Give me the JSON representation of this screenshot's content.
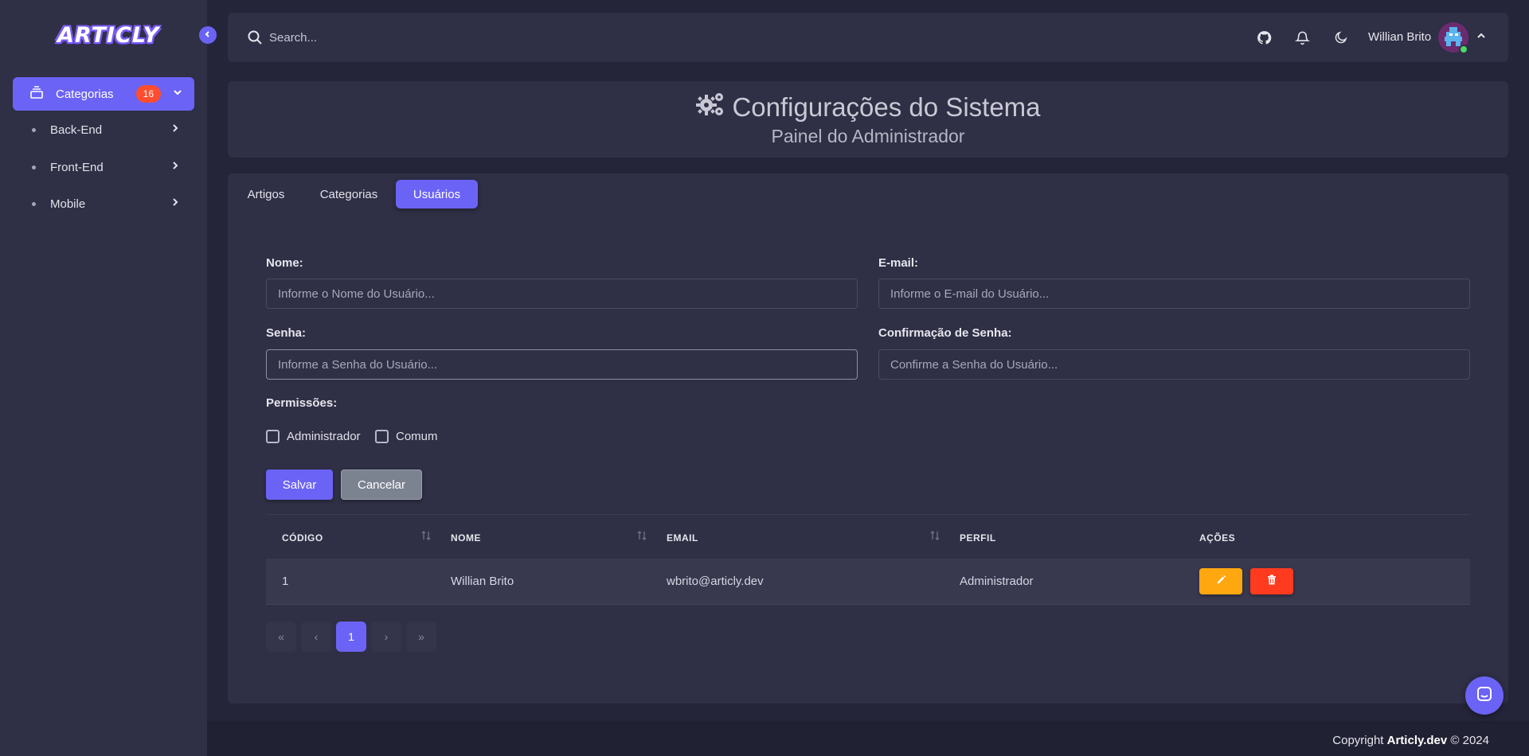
{
  "app": {
    "logo_text": "ARTICLY"
  },
  "sidebar": {
    "main_item": {
      "label": "Categorias",
      "badge": "16"
    },
    "items": [
      {
        "label": "Back-End"
      },
      {
        "label": "Front-End"
      },
      {
        "label": "Mobile"
      }
    ]
  },
  "topbar": {
    "search_placeholder": "Search...",
    "user_name": "Willian Brito",
    "icons": [
      "github-icon",
      "bell-icon",
      "moon-icon"
    ]
  },
  "header": {
    "title": "Configurações do Sistema",
    "subtitle": "Painel do Administrador"
  },
  "tabs": [
    {
      "label": "Artigos",
      "active": false
    },
    {
      "label": "Categorias",
      "active": false
    },
    {
      "label": "Usuários",
      "active": true
    }
  ],
  "form": {
    "nome_label": "Nome:",
    "nome_placeholder": "Informe o Nome do Usuário...",
    "email_label": "E-mail:",
    "email_placeholder": "Informe o E-mail do Usuário...",
    "senha_label": "Senha:",
    "senha_placeholder": "Informe a Senha do Usuário...",
    "confirm_label": "Confirmação de Senha:",
    "confirm_placeholder": "Confirme a Senha do Usuário...",
    "permissions_label": "Permissões:",
    "perm_admin": "Administrador",
    "perm_common": "Comum",
    "save_label": "Salvar",
    "cancel_label": "Cancelar"
  },
  "table": {
    "headers": [
      "CÓDIGO",
      "NOME",
      "EMAIL",
      "PERFIL",
      "AÇÕES"
    ],
    "rows": [
      {
        "codigo": "1",
        "nome": "Willian Brito",
        "email": "wbrito@articly.dev",
        "perfil": "Administrador"
      }
    ]
  },
  "pagination": {
    "first": "«",
    "prev": "‹",
    "current": "1",
    "next": "›",
    "last": "»"
  },
  "footer": {
    "prefix": "Copyright ",
    "brand": "Articly.dev",
    "suffix": " © 2024"
  },
  "colors": {
    "accent": "#6b63f6",
    "danger": "#ff4d2e",
    "warning": "#ffa70f",
    "sidebar_bg": "#2f2f45",
    "page_bg": "#25253a"
  }
}
